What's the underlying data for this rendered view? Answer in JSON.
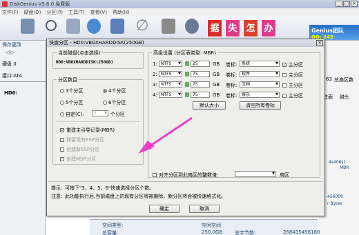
{
  "app": {
    "title": "DiskGenius V3.8.0 免费版",
    "menu": [
      "文件(F)",
      "硬盘(D)",
      "分区(P)",
      "工具(T)",
      "查看(V)",
      "帮助(H)"
    ],
    "ad_text": [
      "据",
      "失",
      "怎",
      "办"
    ],
    "ad_right": "Genius团队",
    "qq": "QQ: 243"
  },
  "left": {
    "save": "保存更改",
    "disk": "硬盘 0",
    "iface": "接口:ATA",
    "tree": "HD0:"
  },
  "right": {
    "cyl": "63",
    "total_sectors": "总扇区数",
    "col_cyl": "柱面",
    "col_head": "磁头",
    "v1": "4s406s1",
    "v1b": "MBR",
    "v2": "456000",
    "v3": "r Bytes"
  },
  "bottom": {
    "space_type": "空间类型:",
    "free": "空闲空间",
    "total_label": "总容量:",
    "total_val": "250.0GB",
    "sectors_label": "总字节数:",
    "sectors_val": "268435456188"
  },
  "dialog": {
    "title": "快速分区 - HD0:VBOXHARDDISK(250GB)",
    "current_disk_label": "当前磁盘(点击选择)",
    "current_disk": "HD0:VBOXHARDDISK(250GB)",
    "partition_count_label": "分区数目",
    "options": [
      "3个分区",
      "4个分区",
      "5个分区",
      "6个分区"
    ],
    "custom_label": "自定(C):",
    "custom_value": "2",
    "custom_suffix": "个分区",
    "checks": [
      {
        "label": "重建主引导记录(MBR)",
        "checked": true,
        "enabled": true
      },
      {
        "label": "保留现有ESP分区",
        "checked": false,
        "enabled": false
      },
      {
        "label": "创建新ESP分区",
        "checked": false,
        "enabled": false
      },
      {
        "label": "创建MSR分区",
        "checked": false,
        "enabled": false
      }
    ],
    "advanced_label": "高级设置 (分区表类型: MBR)",
    "rows": [
      {
        "n": "1:",
        "fs": "NTFS",
        "size": "25",
        "unit": "GB",
        "vol_label": "卷标:",
        "vol": "系统",
        "primary": "主分区",
        "primary_on": true
      },
      {
        "n": "2:",
        "fs": "NTFS",
        "size": "75",
        "unit": "GB",
        "vol_label": "卷标:",
        "vol": "软件",
        "primary": "主分区",
        "primary_on": false
      },
      {
        "n": "3:",
        "fs": "NTFS",
        "size": "75",
        "unit": "GB",
        "vol_label": "卷标:",
        "vol": "文档",
        "primary": "主分区",
        "primary_on": false
      },
      {
        "n": "4:",
        "fs": "NTFS",
        "size": "75",
        "unit": "GB",
        "vol_label": "卷标:",
        "vol": "娱乐",
        "primary": "主分区",
        "primary_on": false
      }
    ],
    "default_size_btn": "默认大小",
    "clear_labels_btn": "清空所有卷标",
    "align_label": "对齐分区到此扇区的整数倍:",
    "align_unit": "扇区",
    "hint_label": "提示:",
    "hint": "可按下\"3、4、5、6\"快速选择分区个数。",
    "note_label": "注意:",
    "note": "此功能执行后,当前磁盘上的现有分区将被删除。新分区将会被快速格式化。",
    "ok": "确定",
    "cancel": "取消"
  }
}
